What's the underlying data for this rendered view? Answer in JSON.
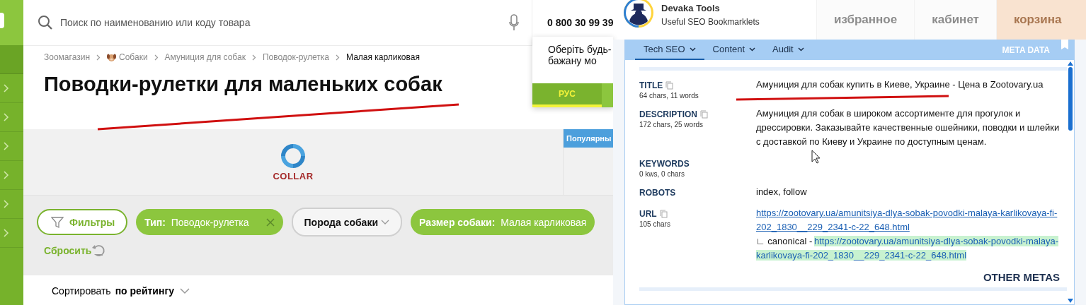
{
  "header": {
    "search": {
      "placeholder": "Поиск по наименованию или коду товара"
    },
    "phone": "0 800 30 99 39",
    "nav": [
      {
        "kind": "favorites",
        "label": "избранное"
      },
      {
        "kind": "account",
        "label": "кабинет"
      },
      {
        "kind": "cart",
        "label": "корзина"
      }
    ]
  },
  "language_popup": {
    "lines": [
      "Оберіть будь-",
      "бажану мо"
    ],
    "buttons": [
      {
        "label": "РУС",
        "selected": true
      }
    ]
  },
  "breadcrumbs": [
    {
      "label": "Зоомагазин",
      "icon": false,
      "current": false
    },
    {
      "label": "Собаки",
      "icon": true,
      "current": false
    },
    {
      "label": "Амуниция для собак",
      "icon": false,
      "current": false
    },
    {
      "label": "Поводок-рулетка",
      "icon": false,
      "current": false
    },
    {
      "label": "Малая карликовая",
      "icon": false,
      "current": true
    }
  ],
  "page_title": "Поводки-рулетки для маленьких собак",
  "brand_logo": "COLLAR",
  "popular_tab": "Популярны",
  "filters": {
    "button": "Фильтры",
    "chips": [
      {
        "kind": "active",
        "label": "Тип:",
        "value": "Поводок-рулетка",
        "removable": true
      },
      {
        "kind": "dropdown",
        "label": "Порода собаки"
      },
      {
        "kind": "active",
        "label": "Размер собаки:",
        "value": "Малая карликовая",
        "removable": false
      }
    ],
    "reset": "Сбросить"
  },
  "sort": {
    "label": "Сортировать",
    "value": "по рейтингу"
  },
  "seo_panel": {
    "title": "Devaka Tools",
    "subtitle": "Useful SEO Bookmarklets",
    "tabs": [
      {
        "label": "Tech SEO",
        "selected": true
      },
      {
        "label": "Content",
        "selected": false
      },
      {
        "label": "Audit",
        "selected": false
      }
    ],
    "section": "META DATA",
    "rows": [
      {
        "kind": "text",
        "label": "TITLE",
        "copyable": true,
        "stats": "64 chars, 11 words",
        "value": "Амуниция для собак купить в Киеве, Украине - Цена в Zootovary.ua"
      },
      {
        "kind": "text",
        "label": "DESCRIPTION",
        "copyable": true,
        "stats": "172 chars, 25 words",
        "value": "Амуниция для собак в широком ассортименте для прогулок и дрессировки. Заказывайте качественные ошейники, поводки и шлейки с доставкой по Киеву и Украине по доступным ценам."
      },
      {
        "kind": "text",
        "label": "KEYWORDS",
        "copyable": false,
        "stats": "0 kws, 0 chars"
      },
      {
        "kind": "text",
        "label": "ROBOTS",
        "copyable": false,
        "value": "index, follow"
      },
      {
        "kind": "url",
        "label": "URL",
        "copyable": true,
        "stats": "105 chars",
        "value": "https://zootovary.ua/amunitsiya-dlya-sobak-povodki-malaya-karlikovaya-fi-202_1830__229_2341-c-22_648.html",
        "canonical_label": "∟ canonical -",
        "canonical": "https://zootovary.ua/amunitsiya-dlya-sobak-povodki-malaya-karlikovaya-fi-202_1830__229_2341-c-22_648.html"
      }
    ],
    "footer": "OTHER METAS"
  }
}
